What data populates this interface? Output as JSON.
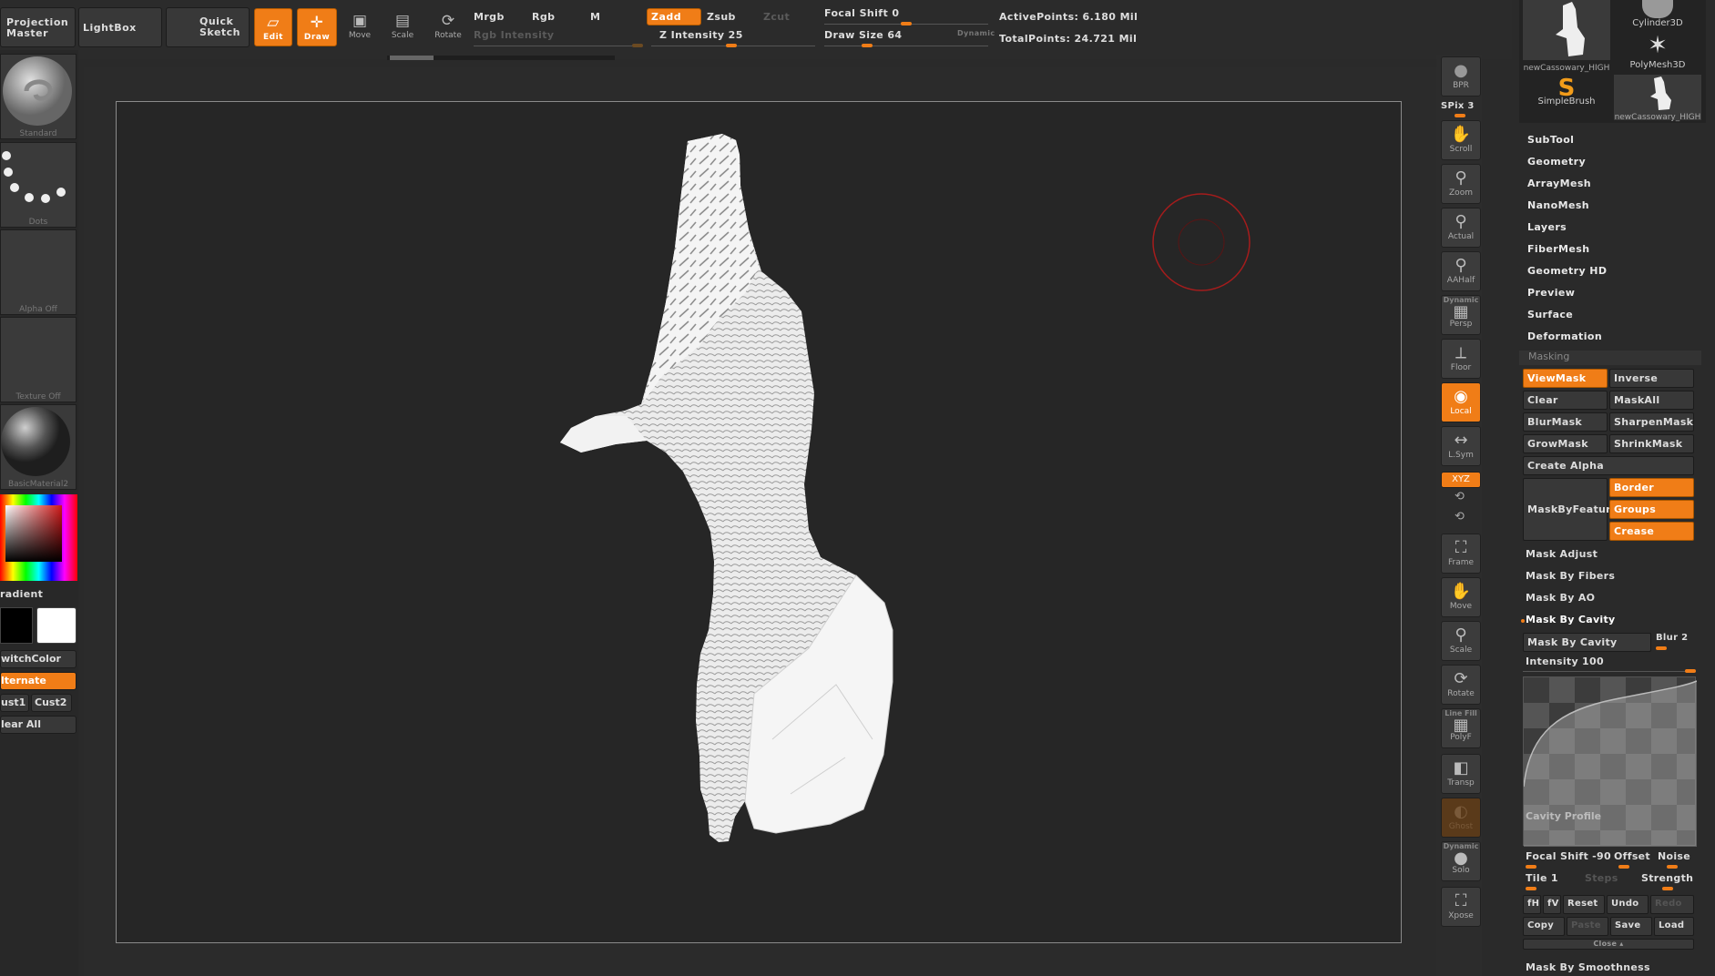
{
  "toolbar": {
    "projection_master": "Projection Master",
    "lightbox": "LightBox",
    "quick_sketch": "Quick Sketch",
    "edit": "Edit",
    "draw": "Draw",
    "move": "Move",
    "scale": "Scale",
    "rotate": "Rotate",
    "mrgb": "Mrgb",
    "rgb": "Rgb",
    "m": "M",
    "zadd": "Zadd",
    "zsub": "Zsub",
    "zcut": "Zcut",
    "rgb_intensity": "Rgb Intensity",
    "z_intensity": "Z Intensity 25",
    "focal_shift": "Focal Shift 0",
    "draw_size": "Draw Size 64",
    "dynamic": "Dynamic",
    "active_points": "ActivePoints: 6.180 Mil",
    "total_points": "TotalPoints: 24.721 Mil"
  },
  "left": {
    "brush": "Standard",
    "stroke": "Dots",
    "alpha": "Alpha Off",
    "texture": "Texture Off",
    "material": "BasicMaterial2",
    "gradient": "radient",
    "switchcolor": "witchColor",
    "alternate": "lternate",
    "cust1": "ust1",
    "cust2": "Cust2",
    "clear_all": "lear All"
  },
  "right_shelf": {
    "bpr": "BPR",
    "spix": "SPix 3",
    "scroll": "Scroll",
    "zoom": "Zoom",
    "actual": "Actual",
    "aahalf": "AAHalf",
    "dynamic": "Dynamic",
    "persp": "Persp",
    "floor": "Floor",
    "local": "Local",
    "lsym": "L.Sym",
    "xyz": "XYZ",
    "frame": "Frame",
    "move": "Move",
    "scale": "Scale",
    "rotate": "Rotate",
    "line_fill": "Line Fill",
    "polyf": "PolyF",
    "transp": "Transp",
    "ghost": "Ghost",
    "dynamic2": "Dynamic",
    "solo": "Solo",
    "xpose": "Xpose"
  },
  "tray": {
    "thumbs": [
      "newCassowary_HIGH",
      "Cylinder3D",
      "PolyMesh3D",
      "SimpleBrush",
      "newCassowary_HIGH"
    ],
    "menu": [
      "SubTool",
      "Geometry",
      "ArrayMesh",
      "NanoMesh",
      "Layers",
      "FiberMesh",
      "Geometry HD",
      "Preview",
      "Surface",
      "Deformation"
    ],
    "masking_header": "Masking",
    "viewmask": "ViewMask",
    "inverse": "Inverse",
    "clear": "Clear",
    "maskall": "MaskAll",
    "blurmask": "BlurMask",
    "sharpenmask": "SharpenMask",
    "growmask": "GrowMask",
    "shrinkmask": "ShrinkMask",
    "create_alpha": "Create Alpha",
    "maskbyfeature": "MaskByFeature",
    "border": "Border",
    "groups": "Groups",
    "crease": "Crease",
    "mask_adjust": "Mask Adjust",
    "mask_by_fibers": "Mask By Fibers",
    "mask_by_ao": "Mask By AO",
    "mask_by_cavity_header": "Mask By Cavity",
    "mask_by_cavity_btn": "Mask By Cavity",
    "blur": "Blur 2",
    "intensity": "Intensity 100",
    "cavity_profile": "Cavity Profile",
    "focal_shift": "Focal Shift -90",
    "offset": "Offset",
    "noise": "Noise",
    "tile": "Tile 1",
    "steps": "Steps",
    "strength": "Strength",
    "fh": "fH",
    "fv": "fV",
    "reset": "Reset",
    "undo": "Undo",
    "redo": "Redo",
    "copy": "Copy",
    "paste": "Paste",
    "save": "Save",
    "load": "Load",
    "close": "Close",
    "mask_by_smoothness": "Mask By Smoothness"
  }
}
